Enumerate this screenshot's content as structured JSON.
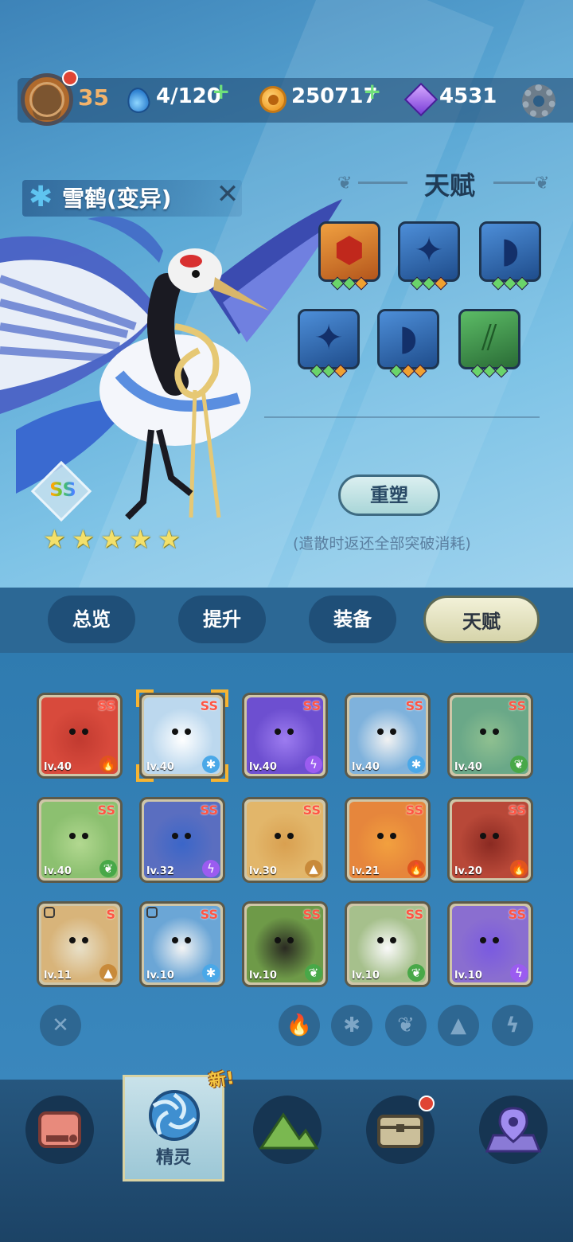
{
  "top_bar": {
    "level": "35",
    "stamina": "4/120",
    "coins": "250717",
    "gems": "4531",
    "plus_symbol": "+"
  },
  "pet": {
    "name": "雪鹤(变异)",
    "element_icon": "snowflake-icon",
    "rank": "SS",
    "stars": 5
  },
  "talent": {
    "title": "天赋",
    "slots": [
      {
        "icon": "hexagon-shield-icon",
        "color": "#e3892d",
        "pips": [
          "green",
          "green",
          "orange"
        ]
      },
      {
        "icon": "shuriken-star-icon",
        "color": "#4d8ed8",
        "pips": [
          "green",
          "green",
          "orange"
        ]
      },
      {
        "icon": "horn-spike-icon",
        "color": "#4d8ed8",
        "pips": [
          "green",
          "green",
          "green"
        ]
      },
      {
        "icon": "shuriken-star-icon",
        "color": "#4d8ed8",
        "pips": [
          "green",
          "green",
          "orange"
        ]
      },
      {
        "icon": "horn-spike-icon",
        "color": "#4d8ed8",
        "pips": [
          "green",
          "orange",
          "orange"
        ]
      },
      {
        "icon": "claw-slash-icon",
        "color": "#3a9a4e",
        "pips": [
          "green",
          "green",
          "green"
        ]
      }
    ],
    "reforge_label": "重塑",
    "note": "(遣散时返还全部突破消耗)"
  },
  "tabs": [
    {
      "label": "总览",
      "active": false
    },
    {
      "label": "提升",
      "active": false
    },
    {
      "label": "装备",
      "active": false
    },
    {
      "label": "天赋",
      "active": true
    }
  ],
  "pets": [
    {
      "lv": "lv.40",
      "rank": "SS",
      "element": "fire",
      "bg": "#d84a3c",
      "face": "#c13a30"
    },
    {
      "lv": "lv.40",
      "rank": "SS",
      "element": "ice",
      "bg": "#bcd8ee",
      "face": "#ffffff",
      "selected": true
    },
    {
      "lv": "lv.40",
      "rank": "SS",
      "element": "lightning",
      "bg": "#6d4fd0",
      "face": "#9d7cf0"
    },
    {
      "lv": "lv.40",
      "rank": "SS",
      "element": "ice",
      "bg": "#7fb2dc",
      "face": "#f2f2f2"
    },
    {
      "lv": "lv.40",
      "rank": "SS",
      "element": "nature",
      "bg": "#6aa888",
      "face": "#8fc090"
    },
    {
      "lv": "lv.40",
      "rank": "SS",
      "element": "nature",
      "bg": "#8cc070",
      "face": "#b2d890"
    },
    {
      "lv": "lv.32",
      "rank": "SS",
      "element": "lightning",
      "bg": "#5a6ec0",
      "face": "#3b66c8"
    },
    {
      "lv": "lv.30",
      "rank": "SS",
      "element": "earth",
      "bg": "#e2b66a",
      "face": "#d9a050"
    },
    {
      "lv": "lv.21",
      "rank": "SS",
      "element": "fire",
      "bg": "#e6863c",
      "face": "#f2a03e"
    },
    {
      "lv": "lv.20",
      "rank": "SS",
      "element": "fire",
      "bg": "#b84838",
      "face": "#8a2a22"
    },
    {
      "lv": "lv.11",
      "rank": "S",
      "element": "earth",
      "bg": "#d8b47a",
      "face": "#e8e0c8",
      "locked": true
    },
    {
      "lv": "lv.10",
      "rank": "SS",
      "element": "ice",
      "bg": "#6ba6d6",
      "face": "#f4f4f4",
      "locked": true
    },
    {
      "lv": "lv.10",
      "rank": "SS",
      "element": "nature",
      "bg": "#6e9a48",
      "face": "#2a2a22"
    },
    {
      "lv": "lv.10",
      "rank": "SS",
      "element": "nature",
      "bg": "#a6c08c",
      "face": "#fafafa"
    },
    {
      "lv": "lv.10",
      "rank": "SS",
      "element": "lightning",
      "bg": "#8a6ed0",
      "face": "#7a5ae0"
    }
  ],
  "filters": [
    {
      "name": "clear-filter",
      "glyph": "✕"
    },
    {
      "name": "fire-filter",
      "glyph": "🔥"
    },
    {
      "name": "ice-filter",
      "glyph": "✱"
    },
    {
      "name": "nature-filter",
      "glyph": "❦"
    },
    {
      "name": "earth-filter",
      "glyph": "▲"
    },
    {
      "name": "lightning-filter",
      "glyph": "ϟ"
    }
  ],
  "bottom_nav": {
    "active_label": "精灵",
    "new_badge": "新!",
    "items": [
      "shop-icon",
      "pet-swirl-icon",
      "mountain-icon",
      "chest-icon",
      "map-pin-icon"
    ]
  }
}
